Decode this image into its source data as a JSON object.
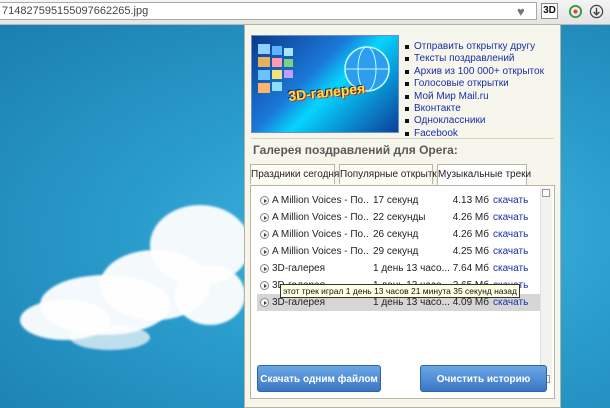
{
  "browser": {
    "url": "714827595155097662265.jpg",
    "heart_icon": "heart-icon",
    "extension_label": "3D"
  },
  "popup": {
    "banner": {
      "title": "3D-галерея"
    },
    "links": [
      "Отправить открытку другу",
      "Тексты поздравлений",
      "Архив из 100 000+ открыток",
      "Голосовые открытки",
      "Мой Мир Mail.ru",
      "Вконтакте",
      "Одноклассники",
      "Facebook"
    ],
    "heading": "Галерея поздравлений для Opera:",
    "tabs": [
      "Праздники сегодня",
      "Популярные открытки",
      "Музыкальные треки"
    ],
    "active_tab": 2,
    "tracks": [
      {
        "title": "A Million Voices - По...",
        "duration": "17 секунд",
        "size": "4.13 Мб",
        "download": "скачать"
      },
      {
        "title": "A Million Voices - По...",
        "duration": "22 секунды",
        "size": "4.26 Мб",
        "download": "скачать"
      },
      {
        "title": "A Million Voices - По...",
        "duration": "26 секунд",
        "size": "4.26 Мб",
        "download": "скачать"
      },
      {
        "title": "A Million Voices - По...",
        "duration": "29 секунд",
        "size": "4.25 Мб",
        "download": "скачать"
      },
      {
        "title": "3D-галерея",
        "duration": "1 день 13 часо...",
        "size": "7.64 Мб",
        "download": "скачать"
      },
      {
        "title": "3D-галерея",
        "duration": "1 день 13 часо...",
        "size": "2.65 Мб",
        "download": "скачать"
      },
      {
        "title": "3D-галерея",
        "duration": "1 день 13 часо...",
        "size": "4.09 Мб",
        "download": "скачать"
      }
    ],
    "selected_track": 6,
    "tooltip": "этот трек играл 1 день 13 часов 21 минута 35 секунд назад",
    "buttons": {
      "download_all": "Скачать одним файлом",
      "clear_history": "Очистить историю"
    }
  },
  "colors": {
    "link": "#1a2fa8",
    "button": "#3b78c5",
    "popup_bg": "#f7f6ec",
    "sky": "#1f8fc0"
  }
}
